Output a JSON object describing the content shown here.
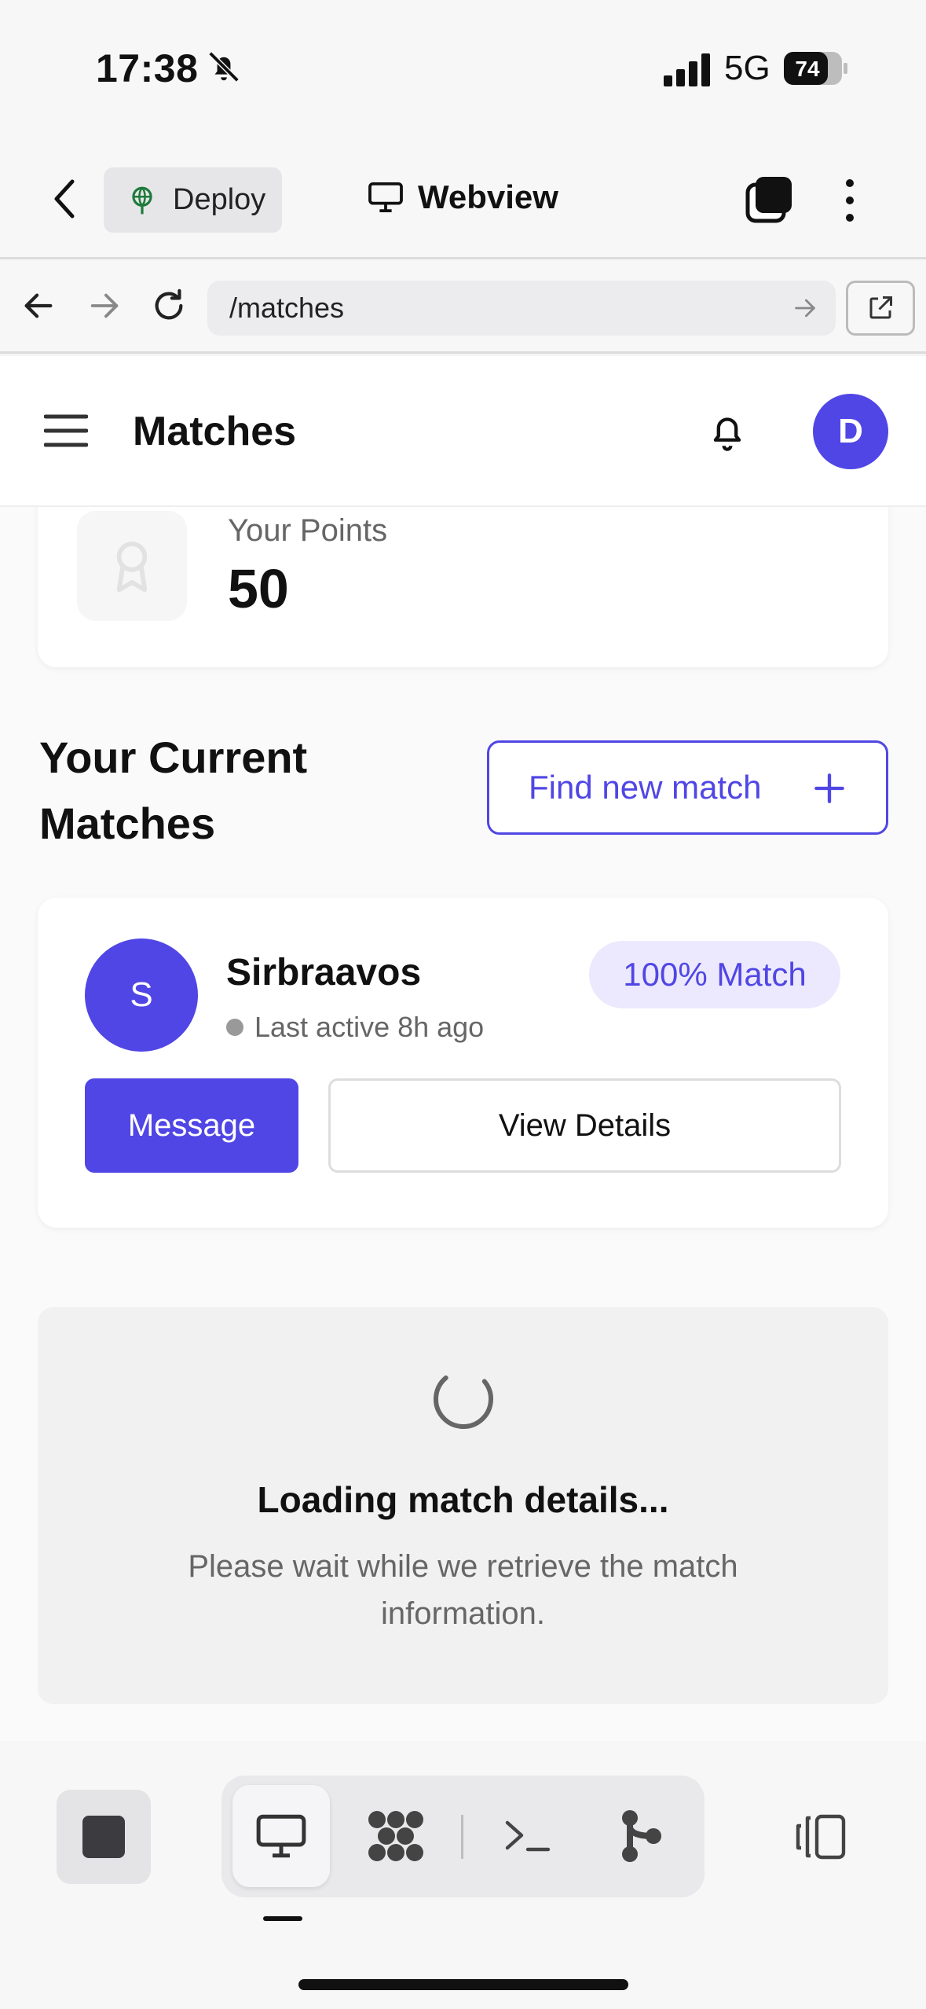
{
  "status": {
    "time": "17:38",
    "network": "5G",
    "battery": "74"
  },
  "toolbar": {
    "deploy_label": "Deploy",
    "webview_label": "Webview"
  },
  "url_bar": {
    "path": "/matches"
  },
  "header": {
    "title": "Matches",
    "avatar_initial": "D"
  },
  "points": {
    "label": "Your Points",
    "value": "50"
  },
  "matches": {
    "section_title": "Your Current Matches",
    "find_label": "Find new match",
    "items": [
      {
        "initial": "S",
        "name": "Sirbraavos",
        "last_active": "Last active 8h ago",
        "badge": "100% Match",
        "message_label": "Message",
        "details_label": "View Details"
      }
    ]
  },
  "loading": {
    "title": "Loading match details...",
    "subtitle": "Please wait while we retrieve the match information."
  },
  "colors": {
    "accent": "#5046e5",
    "badge_bg": "#ece9fe",
    "deploy_icon": "#1e7a3c"
  },
  "icons": [
    "bell-off-icon",
    "signal-icon",
    "battery-icon",
    "chevron-left-icon",
    "deploy-icon",
    "monitor-icon",
    "tabs-icon",
    "kebab-icon",
    "arrow-left-icon",
    "arrow-right-icon",
    "reload-icon",
    "external-link-icon",
    "hamburger-icon",
    "bell-icon",
    "award-icon",
    "plus-icon",
    "spinner-icon",
    "stop-icon",
    "cluster-icon",
    "terminal-icon",
    "branch-icon",
    "panel-icon"
  ]
}
